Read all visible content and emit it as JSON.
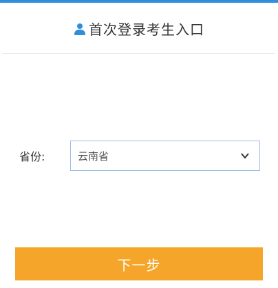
{
  "header": {
    "title": "首次登录考生入口",
    "icon": "user-icon"
  },
  "form": {
    "province_label": "省份:",
    "province_value": "云南省",
    "select_icon": "chevron-down-icon"
  },
  "actions": {
    "next_label": "下一步"
  },
  "colors": {
    "accent_blue": "#2f8fdd",
    "button_orange": "#f5a52a"
  }
}
